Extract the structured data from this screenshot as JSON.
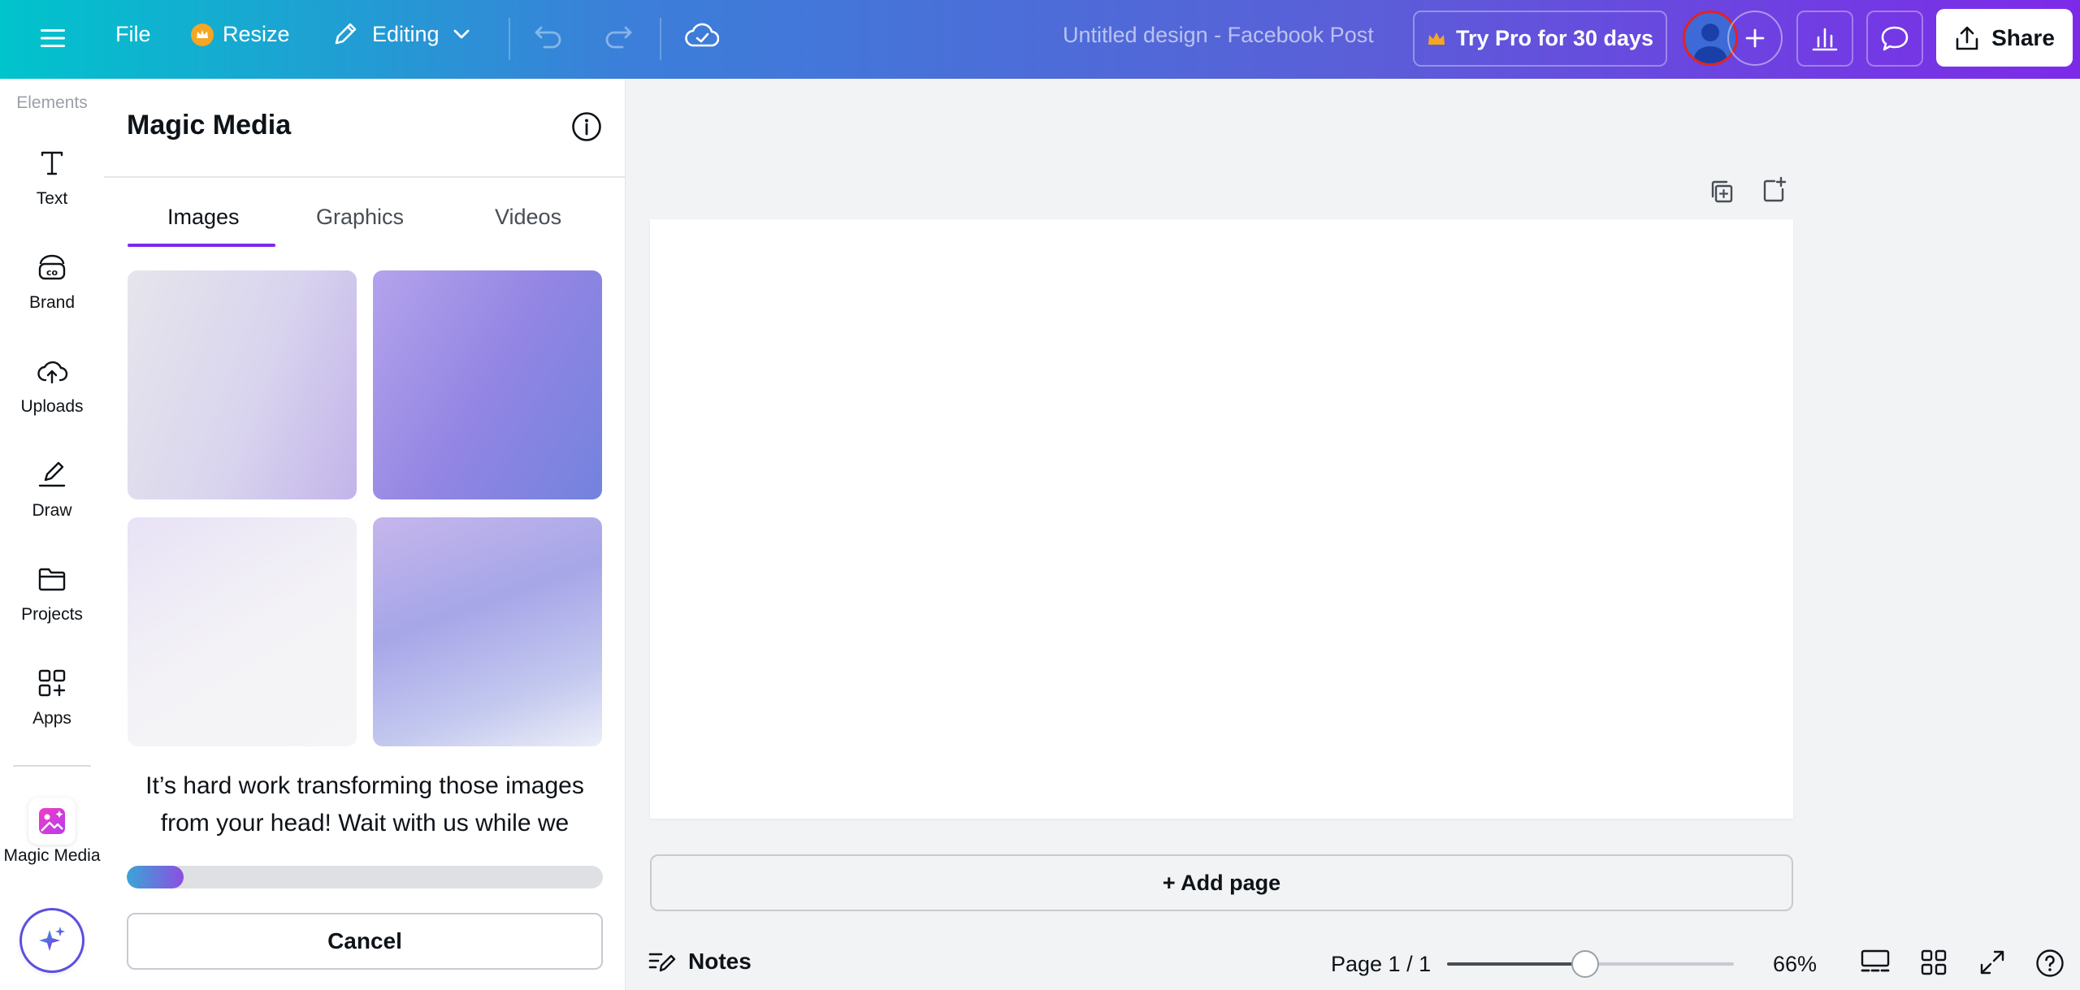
{
  "topbar": {
    "menu_icon": "hamburger-icon",
    "file_label": "File",
    "resize_label": "Resize",
    "editing_label": "Editing",
    "design_title": "Untitled design - Facebook Post",
    "try_pro_label": "Try Pro for 30 days",
    "share_label": "Share"
  },
  "rail": {
    "cut_label": "Elements",
    "items": [
      {
        "label": "Text",
        "icon": "text-icon"
      },
      {
        "label": "Brand",
        "icon": "brand-icon"
      },
      {
        "label": "Uploads",
        "icon": "cloud-upload-icon"
      },
      {
        "label": "Draw",
        "icon": "pen-icon"
      },
      {
        "label": "Projects",
        "icon": "folder-icon"
      },
      {
        "label": "Apps",
        "icon": "apps-icon"
      }
    ],
    "magic_media_label": "Magic Media"
  },
  "panel": {
    "title": "Magic Media",
    "tabs": [
      {
        "label": "Images",
        "active": true
      },
      {
        "label": "Graphics",
        "active": false
      },
      {
        "label": "Videos",
        "active": false
      }
    ],
    "loading_text": "It’s hard work transforming those images from your head! Wait with us while we",
    "progress": 0.12,
    "cancel_label": "Cancel"
  },
  "canvas": {
    "add_page_label": "+ Add page"
  },
  "bottombar": {
    "notes_label": "Notes",
    "page_indicator": "Page 1 / 1",
    "zoom_percent": 66,
    "zoom_label": "66%"
  },
  "colors": {
    "accent": "#7d2ae8",
    "gradient_start": "#00c4cc",
    "gradient_end": "#7d2ae8"
  }
}
